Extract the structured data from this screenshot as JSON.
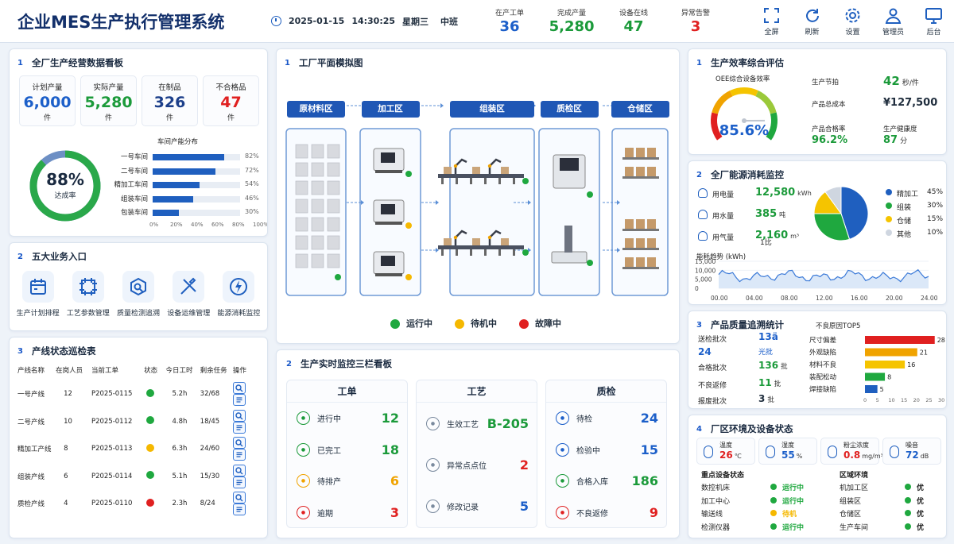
{
  "header": {
    "title": "企业MES生产执行管理系统",
    "date": "2025-01-15",
    "time": "14:30:25",
    "weekday": "星期三",
    "shift": "中班",
    "stats": [
      {
        "label": "在产工单",
        "value": "36",
        "color": "#1c5fc9"
      },
      {
        "label": "完成产量",
        "value": "5,280",
        "color": "#1b9a3a"
      },
      {
        "label": "设备在线",
        "value": "47",
        "color": "#1b9a3a"
      },
      {
        "label": "异常告警",
        "value": "3",
        "color": "#e02020"
      }
    ],
    "actions": [
      {
        "label": "全屏",
        "icon": "fullscreen-icon"
      },
      {
        "label": "刷新",
        "icon": "refresh-icon"
      },
      {
        "label": "设置",
        "icon": "gear-icon"
      },
      {
        "label": "管理员",
        "icon": "user-icon"
      },
      {
        "label": "后台",
        "icon": "monitor-icon"
      }
    ]
  },
  "dashboard": {
    "num": "1",
    "title": "全厂生产经营数据看板",
    "kpis": [
      {
        "label": "计划产量",
        "value": "6,000",
        "unit": "件"
      },
      {
        "label": "实际产量",
        "value": "5,280",
        "unit": "件"
      },
      {
        "label": "在制品",
        "value": "326",
        "unit": "件"
      },
      {
        "label": "不合格品",
        "value": "47",
        "unit": "件"
      }
    ],
    "ring_value": "88%",
    "ring_label": "达成率",
    "ring_percent": 88,
    "bar_title": "车间产能分布",
    "bars": [
      {
        "name": "一号车间",
        "value": 82,
        "label": "82%"
      },
      {
        "name": "二号车间",
        "value": 72,
        "label": "72%"
      },
      {
        "name": "精加工车间",
        "value": 54,
        "label": "54%"
      },
      {
        "name": "组装车间",
        "value": 46,
        "label": "46%"
      },
      {
        "name": "包装车间",
        "value": 30,
        "label": "30%"
      }
    ],
    "bar_ticks": [
      "0%",
      "20%",
      "40%",
      "60%",
      "80%",
      "100%"
    ]
  },
  "entries": {
    "num": "2",
    "title": "五大业务入口",
    "items": [
      {
        "label": "生产计划排程",
        "icon": "calendar-icon"
      },
      {
        "label": "工艺参数管理",
        "icon": "process-icon"
      },
      {
        "label": "质量检测追溯",
        "icon": "inspect-icon"
      },
      {
        "label": "设备运维管理",
        "icon": "tools-icon"
      },
      {
        "label": "能源消耗监控",
        "icon": "energy-icon"
      }
    ]
  },
  "lines": {
    "num": "3",
    "title": "产线状态巡检表",
    "headers": [
      "产线名称",
      "在岗人员",
      "当前工单",
      "状态",
      "今日工时",
      "剩余任务",
      "操作"
    ],
    "rows": [
      {
        "name": "一号产线",
        "staff": "12",
        "order": "P2025-0115",
        "status": "#1fa83f",
        "hours": "5.2h",
        "tasks": "32/68"
      },
      {
        "name": "二号产线",
        "staff": "10",
        "order": "P2025-0112",
        "status": "#1fa83f",
        "hours": "4.8h",
        "tasks": "18/45"
      },
      {
        "name": "精加工产线",
        "staff": "8",
        "order": "P2025-0113",
        "status": "#f5b800",
        "hours": "6.3h",
        "tasks": "24/60"
      },
      {
        "name": "组装产线",
        "staff": "6",
        "order": "P2025-0114",
        "status": "#1fa83f",
        "hours": "5.1h",
        "tasks": "15/30"
      },
      {
        "name": "质检产线",
        "staff": "4",
        "order": "P2025-0110",
        "status": "#e02020",
        "hours": "2.3h",
        "tasks": "8/24"
      }
    ]
  },
  "factory": {
    "num": "1",
    "title": "工厂平面模拟图",
    "zones": [
      "原材料区",
      "加工区",
      "组装区",
      "质检区",
      "仓储区"
    ],
    "legend": [
      {
        "label": "运行中",
        "color": "#1fa83f"
      },
      {
        "label": "待机中",
        "color": "#f5b800"
      },
      {
        "label": "故障中",
        "color": "#e02020"
      }
    ]
  },
  "monitor": {
    "num": "2",
    "title": "生产实时监控三栏看板",
    "columns": [
      {
        "title": "工单",
        "rows": [
          {
            "label": "进行中",
            "value": "12",
            "color": "#1b9a3a",
            "icon": "play-icon"
          },
          {
            "label": "已完工",
            "value": "18",
            "color": "#1b9a3a",
            "icon": "done-icon"
          },
          {
            "label": "待排产",
            "value": "6",
            "color": "#f0a300",
            "icon": "pending-icon"
          },
          {
            "label": "逾期",
            "value": "3",
            "color": "#e02020",
            "icon": "overdue-icon"
          }
        ]
      },
      {
        "title": "工艺",
        "rows": [
          {
            "label": "生效工艺",
            "value": "B-205",
            "color": "#1b9a3a",
            "icon": "process-active-icon"
          },
          {
            "label": "异常点点位",
            "value": "2",
            "color": "#e02020",
            "icon": "alert-point-icon"
          },
          {
            "label": "修改记录",
            "value": "5",
            "color": "#1c5fc9",
            "icon": "record-icon"
          }
        ]
      },
      {
        "title": "质检",
        "rows": [
          {
            "label": "待检",
            "value": "24",
            "color": "#1c5fc9",
            "icon": "wait-check-icon"
          },
          {
            "label": "检验中",
            "value": "15",
            "color": "#1c5fc9",
            "icon": "checking-icon"
          },
          {
            "label": "合格入库",
            "value": "186",
            "color": "#1b9a3a",
            "icon": "pass-icon"
          },
          {
            "label": "不良返修",
            "value": "9",
            "color": "#e02020",
            "icon": "repair-icon"
          }
        ]
      }
    ]
  },
  "efficiency": {
    "num": "1",
    "title": "生产效率综合评估",
    "oee_label": "OEE综合设备效率",
    "oee_value": "85.6%",
    "oee_percent": 85.6,
    "metrics": [
      {
        "label": "生产节拍",
        "value": "42",
        "unit": "秒/件",
        "color": "#1b9a3a"
      },
      {
        "label": "产品总成本",
        "value": "¥127,500",
        "unit": "",
        "color": "#1f2d3d"
      },
      {
        "label": "产品合格率",
        "value": "96.2%",
        "unit": "",
        "color": "#1b9a3a"
      },
      {
        "label": "生产健康度",
        "value": "87",
        "unit": "分",
        "color": "#1b9a3a"
      }
    ]
  },
  "energy": {
    "num": "2",
    "title": "全厂能源消耗监控",
    "items": [
      {
        "label": "用电量",
        "value": "12,580",
        "unit": "kWh"
      },
      {
        "label": "用水量",
        "value": "385",
        "unit": "吨"
      },
      {
        "label": "用气量",
        "value": "2,160",
        "unit": "m³"
      }
    ],
    "note": "1比",
    "pie": [
      {
        "name": "精加工",
        "value": 45,
        "label": "45%",
        "color": "#1f5fbf"
      },
      {
        "name": "组装",
        "value": 30,
        "label": "30%",
        "color": "#1fa83f"
      },
      {
        "name": "仓储",
        "value": 15,
        "label": "15%",
        "color": "#f5c400"
      },
      {
        "name": "其他",
        "value": 10,
        "label": "10%",
        "color": "#cfd6e0"
      }
    ],
    "trend_title": "能耗趋势 (kWh)",
    "trend_yticks": [
      "15,000",
      "10,000",
      "5,000",
      "0"
    ],
    "trend_xticks": [
      "00.00",
      "04.00",
      "08.00",
      "12.00",
      "16.00",
      "20.00",
      "24.00"
    ]
  },
  "quality": {
    "num": "3",
    "title": "产品质量追溯统计",
    "stats": [
      {
        "label": "送检批次",
        "value": "13ä",
        "sub": "24",
        "sub2": "光批"
      },
      {
        "label": "合格批次",
        "value": "136",
        "unit": "批"
      },
      {
        "label": "不良返修",
        "value": "11",
        "unit": "批"
      },
      {
        "label": "报废批次",
        "value": "3",
        "unit": "批"
      }
    ],
    "defect_title": "不良原因TOP5",
    "defects": [
      {
        "name": "尺寸偏差",
        "value": 28,
        "color": "#e02020"
      },
      {
        "name": "外观缺陷",
        "value": 21,
        "color": "#f0a300"
      },
      {
        "name": "材料不良",
        "value": 16,
        "color": "#f5c400"
      },
      {
        "name": "装配松动",
        "value": 8,
        "color": "#1fa83f"
      },
      {
        "name": "焊接缺陷",
        "value": 5,
        "color": "#1f5fbf"
      }
    ],
    "defect_ticks": [
      "0",
      "5",
      "10",
      "15",
      "20",
      "25",
      "30"
    ]
  },
  "env": {
    "num": "4",
    "title": "厂区环境及设备状态",
    "cards": [
      {
        "label": "温度",
        "value": "26",
        "unit": "℃",
        "color": "#e02020",
        "icon": "thermometer-icon"
      },
      {
        "label": "湿度",
        "value": "55",
        "unit": "%",
        "color": "#1c5fc9",
        "icon": "droplet-icon"
      },
      {
        "label": "粉尘浓度",
        "value": "0.8",
        "unit": "mg/m³",
        "color": "#e02020",
        "icon": "dust-icon"
      },
      {
        "label": "噪音",
        "value": "72",
        "unit": "dB",
        "color": "#1c5fc9",
        "icon": "noise-icon"
      }
    ],
    "equip_title": "重点设备状态",
    "equip": [
      {
        "name": "数控机床",
        "status": "运行中",
        "color": "#1fa83f"
      },
      {
        "name": "加工中心",
        "status": "运行中",
        "color": "#1fa83f"
      },
      {
        "name": "输送线",
        "status": "待机",
        "color": "#f5b800"
      },
      {
        "name": "检测仪器",
        "status": "运行中",
        "color": "#1fa83f"
      }
    ],
    "area_title": "区域环境",
    "areas": [
      {
        "name": "机加工区",
        "status": "优"
      },
      {
        "name": "组装区",
        "status": "优"
      },
      {
        "name": "仓储区",
        "status": "优"
      },
      {
        "name": "生产车间",
        "status": "优"
      }
    ]
  }
}
